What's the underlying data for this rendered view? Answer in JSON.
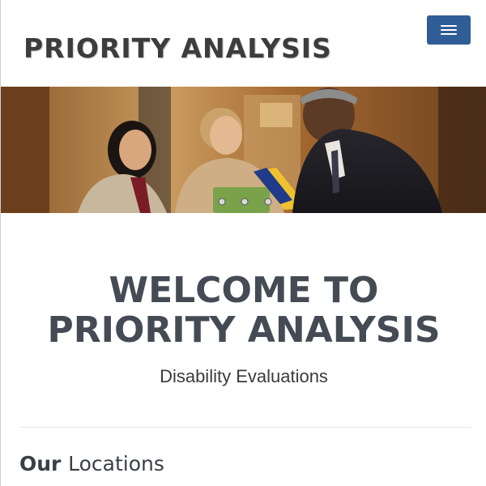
{
  "header": {
    "logo_text": "PRIORITY ANALYSIS",
    "menu_icon": "hamburger-menu-icon",
    "accent_color": "#2f5d95"
  },
  "hero": {
    "image_description_icon": "business-meeting-photo"
  },
  "welcome": {
    "title_line1": "WELCOME TO",
    "title_line2": "PRIORITY ANALYSIS",
    "subtitle": "Disability Evaluations"
  },
  "locations": {
    "heading_strong": "Our",
    "heading_light": "Locations"
  }
}
